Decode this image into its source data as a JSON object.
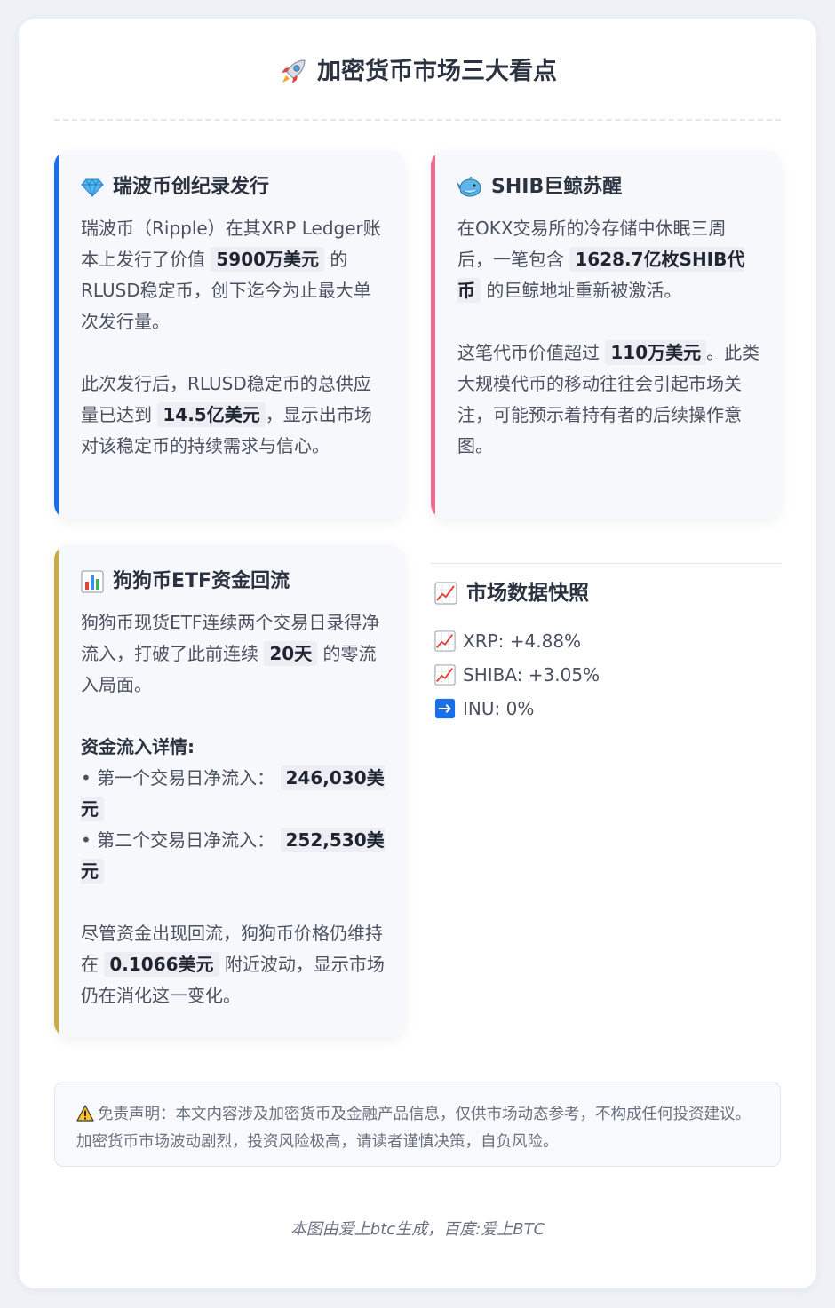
{
  "header": {
    "title": "加密货币市场三大看点",
    "icon": "rocket-icon"
  },
  "cards": {
    "ripple": {
      "accent": "#1a6fe8",
      "icon": "gem-icon",
      "title": "瑞波币创纪录发行",
      "p1_a": "瑞波币（Ripple）在其XRP Ledger账本上发行了价值 ",
      "p1_hl": "5900万美元",
      "p1_b": " 的RLUSD稳定币，创下迄今为止最大单次发行量。",
      "p2_a": "此次发行后，RLUSD稳定币的总供应量已达到 ",
      "p2_hl": "14.5亿美元",
      "p2_b": "，显示出市场对该稳定币的持续需求与信心。"
    },
    "shib": {
      "accent": "#f06a93",
      "icon": "whale-icon",
      "title": "SHIB巨鲸苏醒",
      "p1_a": "在OKX交易所的冷存储中休眠三周后，一笔包含 ",
      "p1_hl": "1628.7亿枚SHIB代币",
      "p1_b": " 的巨鲸地址重新被激活。",
      "p2_a": "这笔代币价值超过 ",
      "p2_hl": "110万美元",
      "p2_b": "。此类大规模代币的移动往往会引起市场关注，可能预示着持有者的后续操作意图。"
    },
    "doge": {
      "accent": "#c9a94a",
      "icon": "bar-chart-icon",
      "title": "狗狗币ETF资金回流",
      "p1_a": "狗狗币现货ETF连续两个交易日录得净流入，打破了此前连续 ",
      "p1_hl": "20天",
      "p1_b": " 的零流入局面。",
      "detail_title": "资金流入详情:",
      "day1_label": "• 第一个交易日净流入：",
      "day1_value": "246,030美元",
      "day2_label": "• 第二个交易日净流入：",
      "day2_value": "252,530美元",
      "p3_a": "尽管资金出现回流，狗狗币价格仍维持在 ",
      "p3_hl": "0.1066美元",
      "p3_b": " 附近波动，显示市场仍在消化这一变化。"
    }
  },
  "snapshot": {
    "icon": "chart-increasing-icon",
    "title": "市场数据快照",
    "items": [
      {
        "icon": "chart-increasing-icon",
        "text": "XRP: +4.88%"
      },
      {
        "icon": "chart-increasing-icon",
        "text": "SHIBA: +3.05%"
      },
      {
        "icon": "right-arrow-icon",
        "text": "INU: 0%"
      }
    ]
  },
  "disclaimer": {
    "icon": "warning-icon",
    "text": "免责声明：本文内容涉及加密货币及金融产品信息，仅供市场动态参考，不构成任何投资建议。加密货币市场波动剧烈，投资风险极高，请读者谨慎决策，自负风险。"
  },
  "footer": {
    "text": "本图由爱上btc生成，百度:爱上BTC"
  }
}
